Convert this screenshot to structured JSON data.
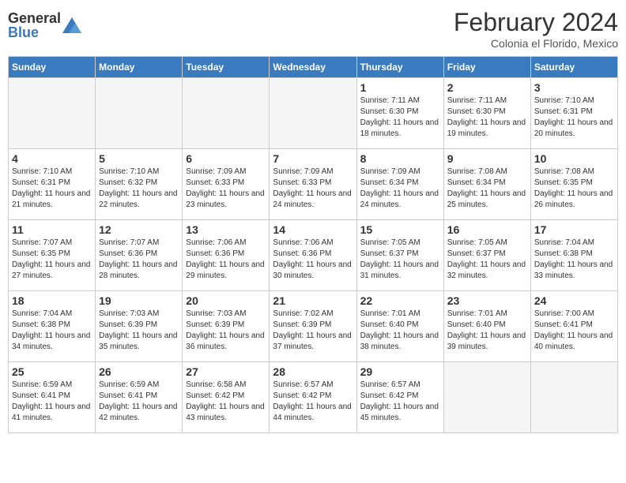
{
  "logo": {
    "general": "General",
    "blue": "Blue"
  },
  "header": {
    "month_year": "February 2024",
    "location": "Colonia el Florido, Mexico"
  },
  "days_of_week": [
    "Sunday",
    "Monday",
    "Tuesday",
    "Wednesday",
    "Thursday",
    "Friday",
    "Saturday"
  ],
  "weeks": [
    [
      {
        "day": "",
        "info": ""
      },
      {
        "day": "",
        "info": ""
      },
      {
        "day": "",
        "info": ""
      },
      {
        "day": "",
        "info": ""
      },
      {
        "day": "1",
        "info": "Sunrise: 7:11 AM\nSunset: 6:30 PM\nDaylight: 11 hours and 18 minutes."
      },
      {
        "day": "2",
        "info": "Sunrise: 7:11 AM\nSunset: 6:30 PM\nDaylight: 11 hours and 19 minutes."
      },
      {
        "day": "3",
        "info": "Sunrise: 7:10 AM\nSunset: 6:31 PM\nDaylight: 11 hours and 20 minutes."
      }
    ],
    [
      {
        "day": "4",
        "info": "Sunrise: 7:10 AM\nSunset: 6:31 PM\nDaylight: 11 hours and 21 minutes."
      },
      {
        "day": "5",
        "info": "Sunrise: 7:10 AM\nSunset: 6:32 PM\nDaylight: 11 hours and 22 minutes."
      },
      {
        "day": "6",
        "info": "Sunrise: 7:09 AM\nSunset: 6:33 PM\nDaylight: 11 hours and 23 minutes."
      },
      {
        "day": "7",
        "info": "Sunrise: 7:09 AM\nSunset: 6:33 PM\nDaylight: 11 hours and 24 minutes."
      },
      {
        "day": "8",
        "info": "Sunrise: 7:09 AM\nSunset: 6:34 PM\nDaylight: 11 hours and 24 minutes."
      },
      {
        "day": "9",
        "info": "Sunrise: 7:08 AM\nSunset: 6:34 PM\nDaylight: 11 hours and 25 minutes."
      },
      {
        "day": "10",
        "info": "Sunrise: 7:08 AM\nSunset: 6:35 PM\nDaylight: 11 hours and 26 minutes."
      }
    ],
    [
      {
        "day": "11",
        "info": "Sunrise: 7:07 AM\nSunset: 6:35 PM\nDaylight: 11 hours and 27 minutes."
      },
      {
        "day": "12",
        "info": "Sunrise: 7:07 AM\nSunset: 6:36 PM\nDaylight: 11 hours and 28 minutes."
      },
      {
        "day": "13",
        "info": "Sunrise: 7:06 AM\nSunset: 6:36 PM\nDaylight: 11 hours and 29 minutes."
      },
      {
        "day": "14",
        "info": "Sunrise: 7:06 AM\nSunset: 6:36 PM\nDaylight: 11 hours and 30 minutes."
      },
      {
        "day": "15",
        "info": "Sunrise: 7:05 AM\nSunset: 6:37 PM\nDaylight: 11 hours and 31 minutes."
      },
      {
        "day": "16",
        "info": "Sunrise: 7:05 AM\nSunset: 6:37 PM\nDaylight: 11 hours and 32 minutes."
      },
      {
        "day": "17",
        "info": "Sunrise: 7:04 AM\nSunset: 6:38 PM\nDaylight: 11 hours and 33 minutes."
      }
    ],
    [
      {
        "day": "18",
        "info": "Sunrise: 7:04 AM\nSunset: 6:38 PM\nDaylight: 11 hours and 34 minutes."
      },
      {
        "day": "19",
        "info": "Sunrise: 7:03 AM\nSunset: 6:39 PM\nDaylight: 11 hours and 35 minutes."
      },
      {
        "day": "20",
        "info": "Sunrise: 7:03 AM\nSunset: 6:39 PM\nDaylight: 11 hours and 36 minutes."
      },
      {
        "day": "21",
        "info": "Sunrise: 7:02 AM\nSunset: 6:39 PM\nDaylight: 11 hours and 37 minutes."
      },
      {
        "day": "22",
        "info": "Sunrise: 7:01 AM\nSunset: 6:40 PM\nDaylight: 11 hours and 38 minutes."
      },
      {
        "day": "23",
        "info": "Sunrise: 7:01 AM\nSunset: 6:40 PM\nDaylight: 11 hours and 39 minutes."
      },
      {
        "day": "24",
        "info": "Sunrise: 7:00 AM\nSunset: 6:41 PM\nDaylight: 11 hours and 40 minutes."
      }
    ],
    [
      {
        "day": "25",
        "info": "Sunrise: 6:59 AM\nSunset: 6:41 PM\nDaylight: 11 hours and 41 minutes."
      },
      {
        "day": "26",
        "info": "Sunrise: 6:59 AM\nSunset: 6:41 PM\nDaylight: 11 hours and 42 minutes."
      },
      {
        "day": "27",
        "info": "Sunrise: 6:58 AM\nSunset: 6:42 PM\nDaylight: 11 hours and 43 minutes."
      },
      {
        "day": "28",
        "info": "Sunrise: 6:57 AM\nSunset: 6:42 PM\nDaylight: 11 hours and 44 minutes."
      },
      {
        "day": "29",
        "info": "Sunrise: 6:57 AM\nSunset: 6:42 PM\nDaylight: 11 hours and 45 minutes."
      },
      {
        "day": "",
        "info": ""
      },
      {
        "day": "",
        "info": ""
      }
    ]
  ]
}
